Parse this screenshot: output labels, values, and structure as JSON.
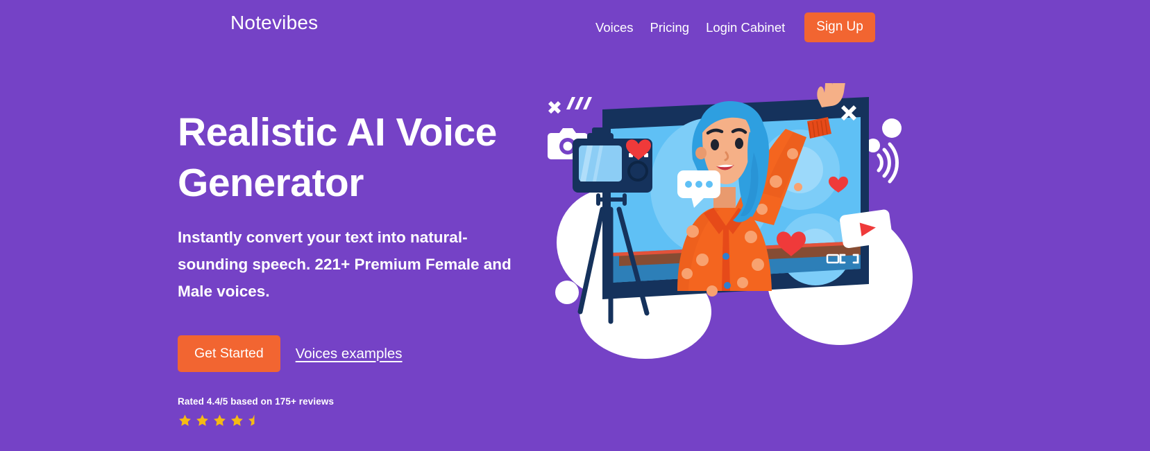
{
  "theme": {
    "background_purple": "#7542c6",
    "accent_orange": "#f26531",
    "text_white": "#ffffff",
    "star_gold": "#f5ba14"
  },
  "header": {
    "brand": "Notevibes",
    "nav": [
      {
        "label": "Voices",
        "name": "nav-voices"
      },
      {
        "label": "Pricing",
        "name": "nav-pricing"
      },
      {
        "label": "Login Cabinet",
        "name": "nav-login-cabinet"
      }
    ],
    "signup_label": "Sign Up"
  },
  "hero": {
    "title_line1": "Realistic AI Voice",
    "title_line2": "Generator",
    "subtitle": "Instantly convert your text into natural-sounding speech. 221+ Premium Female and Male voices.",
    "primary_cta": "Get Started",
    "secondary_cta": "Voices examples",
    "rating": {
      "prefix": "Rated ",
      "score": "4.4/5",
      "suffix": " based on 175+ reviews",
      "value": 4.4,
      "max": 5,
      "reviews": "175+",
      "full_stars": 4,
      "half_stars": 1
    }
  },
  "illustration": {
    "name": "video-recording-illustration",
    "alt": "Woman with blue hair waving inside a video player window, with a tripod camera, hearts, chat bubble and play button",
    "elements": [
      "video-player-window",
      "close-icon",
      "tripod-camera",
      "camera-icon",
      "sparkle-x-icon",
      "chat-bubble-icon",
      "heart-icon",
      "play-button-icon",
      "wifi-arcs-icon",
      "fullscreen-icon",
      "picture-in-picture-icon"
    ],
    "colors": {
      "screen_blue": "#5fc0f5",
      "frame_navy": "#15325c",
      "shirt_orange": "#f4651f",
      "hair_blue": "#2e9fe0",
      "heart_red": "#ef3a3a",
      "skin": "#f5b087"
    }
  }
}
